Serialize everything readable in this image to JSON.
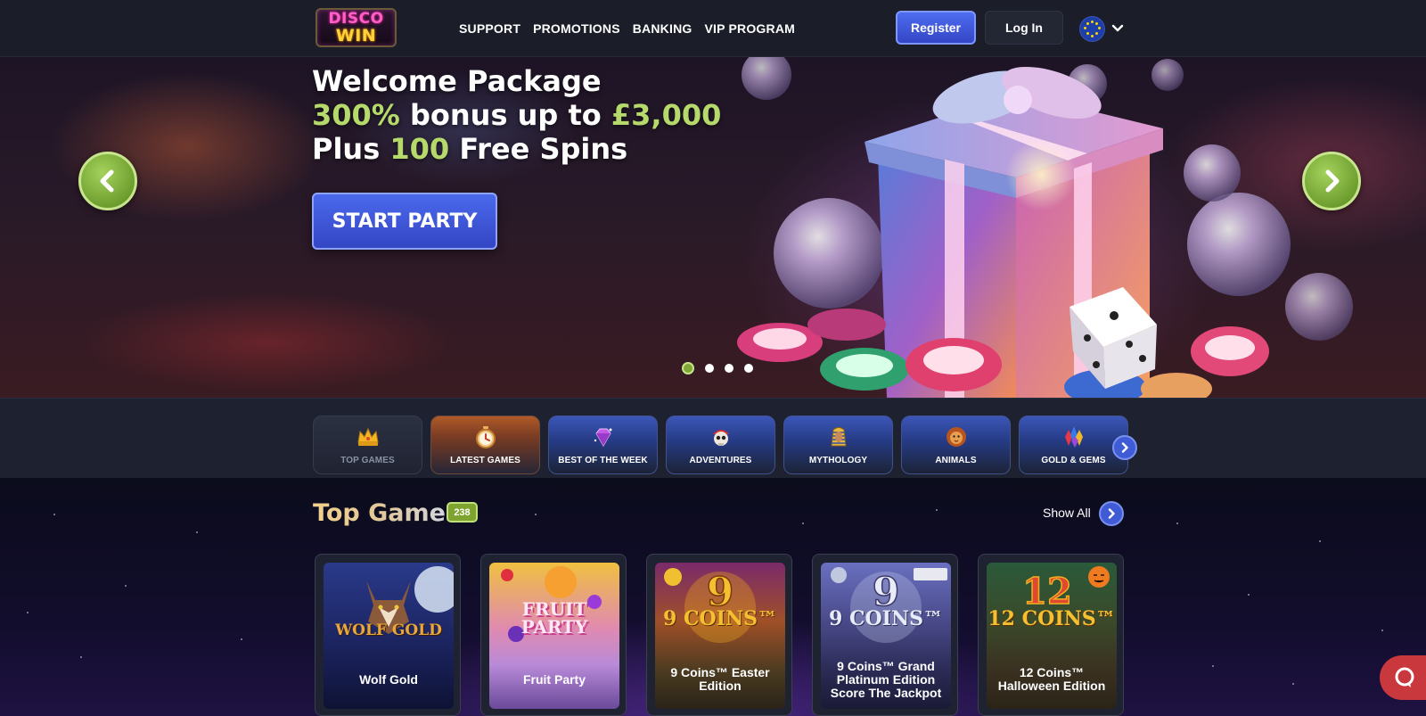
{
  "header": {
    "logo": {
      "line1": "DISCO",
      "line2": "WIN"
    },
    "nav": [
      "SUPPORT",
      "PROMOTIONS",
      "BANKING",
      "VIP PROGRAM"
    ],
    "register_label": "Register",
    "login_label": "Log In",
    "language_icon": "eu-flag-icon"
  },
  "hero": {
    "line1": "Welcome Package",
    "line2_accent1": "300%",
    "line2_mid": " bonus up to ",
    "line2_accent2": "£3,000",
    "line3_start": "Plus ",
    "line3_accent": "100",
    "line3_end": " Free Spins",
    "cta_label": "START PARTY",
    "slides_total": 4,
    "active_slide": 1,
    "accent_color": "#b5d96a"
  },
  "categories": [
    {
      "label": "TOP GAMES",
      "icon": "crown-icon",
      "active": true
    },
    {
      "label": "LATEST GAMES",
      "icon": "stopwatch-icon"
    },
    {
      "label": "BEST OF THE WEEK",
      "icon": "gem-icon"
    },
    {
      "label": "ADVENTURES",
      "icon": "pirate-skull-icon"
    },
    {
      "label": "MYTHOLOGY",
      "icon": "pharaoh-icon"
    },
    {
      "label": "ANIMALS",
      "icon": "lion-icon"
    },
    {
      "label": "GOLD & GEMS",
      "icon": "gems-icon"
    }
  ],
  "games_section": {
    "title": "Top Games",
    "count": "238",
    "show_all_label": "Show All",
    "games": [
      {
        "title": "Wolf Gold",
        "art_text": "WOLF GOLD"
      },
      {
        "title": "Fruit Party",
        "art_text": "FRUIT PARTY"
      },
      {
        "title": "9 Coins™ Easter Edition",
        "art_text": "9 COINS™"
      },
      {
        "title": "9 Coins™ Grand Platinum Edition Score The Jackpot",
        "art_text": "9 COINS™"
      },
      {
        "title": "12 Coins™ Halloween Edition",
        "art_text": "12 COINS™"
      }
    ]
  }
}
